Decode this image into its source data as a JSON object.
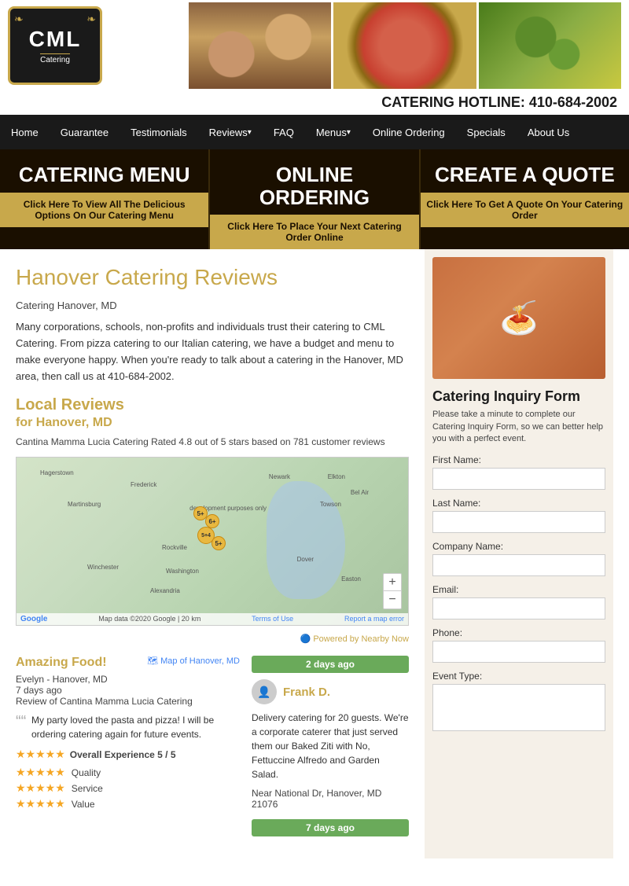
{
  "header": {
    "logo": {
      "brand": "CML",
      "tagline": "Catering"
    },
    "hotline_label": "CATERING HOTLINE:",
    "hotline_number": "410-684-2002"
  },
  "nav": {
    "items": [
      {
        "label": "Home",
        "has_arrow": false
      },
      {
        "label": "Guarantee",
        "has_arrow": false
      },
      {
        "label": "Testimonials",
        "has_arrow": false
      },
      {
        "label": "Reviews",
        "has_arrow": true
      },
      {
        "label": "FAQ",
        "has_arrow": false
      },
      {
        "label": "Menus",
        "has_arrow": true
      },
      {
        "label": "Online Ordering",
        "has_arrow": false
      },
      {
        "label": "Specials",
        "has_arrow": false
      },
      {
        "label": "About Us",
        "has_arrow": false
      }
    ]
  },
  "banner": {
    "btn1": {
      "title": "CATERING MENU",
      "subtitle": "Click Here To View All The Delicious Options On Our Catering Menu"
    },
    "btn2": {
      "title": "ONLINE ORDERING",
      "subtitle": "Click Here To Place Your Next Catering Order Online"
    },
    "btn3": {
      "title": "CREATE A QUOTE",
      "subtitle": "Click Here To Get A Quote On Your Catering Order"
    }
  },
  "main": {
    "page_title": "Hanover Catering Reviews",
    "subtitle": "Catering Hanover, MD",
    "description": "Many corporations, schools, non-profits and individuals trust their catering to CML Catering. From pizza catering to our Italian catering, we have a budget and menu to make everyone happy. When you're ready to talk about a catering in the Hanover, MD area, then call us at 410-684-2002.",
    "local_reviews_title": "Local Reviews",
    "local_reviews_sub": "for Hanover, MD",
    "rating_text": "Cantina Mamma Lucia Catering Rated 4.8 out of 5 stars based on 781 customer reviews",
    "powered_by": "Powered by Nearby Now",
    "review_left": {
      "title": "Amazing Food!",
      "map_link": "Map of Hanover, MD",
      "reviewer": "Evelyn - Hanover, MD",
      "time_ago": "7 days ago",
      "review_for": "Review of Cantina Mamma Lucia Catering",
      "quote": "My party loved the pasta and pizza! I will be ordering catering again for future events.",
      "overall": "Overall Experience 5 / 5",
      "stars_overall": "★★★★★",
      "ratings": [
        {
          "label": "Quality",
          "stars": "★★★★★"
        },
        {
          "label": "Service",
          "stars": "★★★★★"
        },
        {
          "label": "Value",
          "stars": "★★★★★"
        }
      ]
    },
    "review_right": {
      "time_badge": "2 days ago",
      "reviewer_name": "Frank D.",
      "body": "Delivery catering for 20 guests. We're a corporate caterer that just served them our Baked Ziti with No, Fettuccine Alfredo and Garden Salad.",
      "near": "Near National Dr, Hanover, MD 21076"
    },
    "time_badge2": "7 days ago"
  },
  "sidebar": {
    "inquiry_title": "Catering Inquiry Form",
    "inquiry_desc": "Please take a minute to complete our Catering Inquiry Form, so we can better help you with a perfect event.",
    "fields": [
      {
        "label": "First Name:",
        "type": "input",
        "name": "first-name"
      },
      {
        "label": "Last Name:",
        "type": "input",
        "name": "last-name"
      },
      {
        "label": "Company Name:",
        "type": "input",
        "name": "company-name"
      },
      {
        "label": "Email:",
        "type": "input",
        "name": "email"
      },
      {
        "label": "Phone:",
        "type": "input",
        "name": "phone"
      },
      {
        "label": "Event Type:",
        "type": "textarea",
        "name": "event-type"
      }
    ]
  }
}
